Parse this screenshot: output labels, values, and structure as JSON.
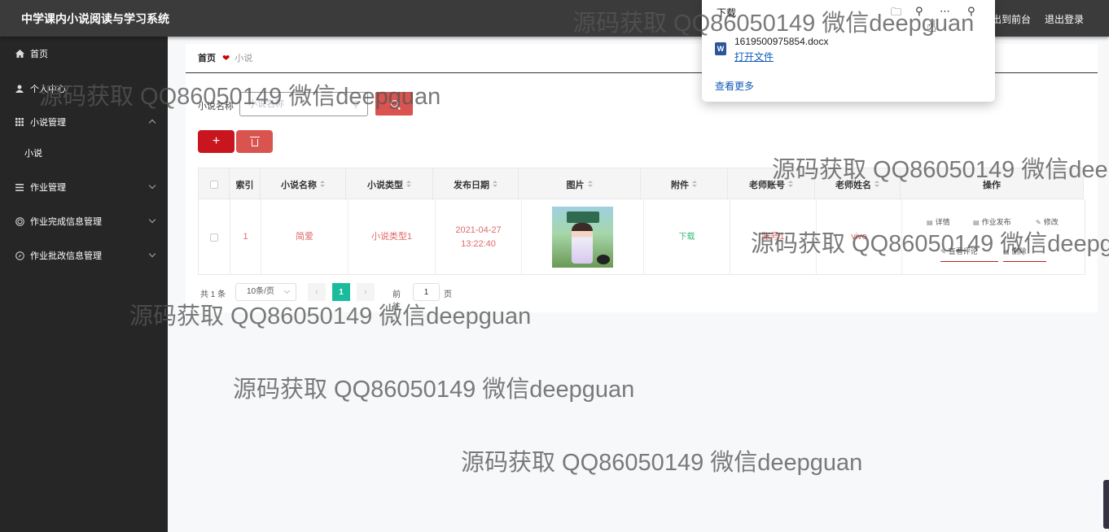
{
  "header": {
    "title": "中学课内小说阅读与学习系统",
    "front_link": "出到前台",
    "logout_link": "退出登录"
  },
  "sidebar": {
    "items": [
      {
        "label": "首页",
        "icon": "home-icon"
      },
      {
        "label": "个人中心",
        "icon": "user-icon"
      },
      {
        "label": "小说管理",
        "icon": "grid-icon"
      },
      {
        "label": "小说",
        "icon": ""
      },
      {
        "label": "作业管理",
        "icon": "list-icon"
      },
      {
        "label": "作业完成信息管理",
        "icon": "target-icon"
      },
      {
        "label": "作业批改信息管理",
        "icon": "compass-icon"
      }
    ]
  },
  "breadcrumb": {
    "home": "首页",
    "current": "小说"
  },
  "search": {
    "label": "小说名称",
    "placeholder": "小说名称"
  },
  "toolbar": {
    "add_label": "+"
  },
  "table": {
    "columns": [
      "索引",
      "小说名称",
      "小说类型",
      "发布日期",
      "图片",
      "附件",
      "老师账号",
      "老师姓名",
      "操作"
    ],
    "rows": [
      {
        "index": "1",
        "name": "简爱",
        "type": "小说类型1",
        "date": "2021-04-27 13:22:40",
        "attachment": "下载",
        "teacher_account": "账号1",
        "teacher_name": "vivo",
        "actions": [
          "详情",
          "作业发布",
          "修改",
          "查看评论",
          "删除"
        ]
      }
    ]
  },
  "pagination": {
    "total": "共 1 条",
    "page_size": "10条/页",
    "current_page": "1",
    "goto_label": "前往",
    "goto_value": "1",
    "page_unit": "页"
  },
  "download_popup": {
    "title": "下载",
    "file_name": "1619500975854.docx",
    "open_file": "打开文件",
    "see_more": "查看更多",
    "file_icon_letter": "W"
  },
  "watermark": {
    "text": "源码获取 QQ86050149 微信deepguan"
  },
  "colors": {
    "topbar": "#3b3b3b",
    "sidebar": "#262626",
    "accent_red": "#c9151e",
    "search_button": "#d9534f",
    "pager_active": "#1abc9c"
  }
}
